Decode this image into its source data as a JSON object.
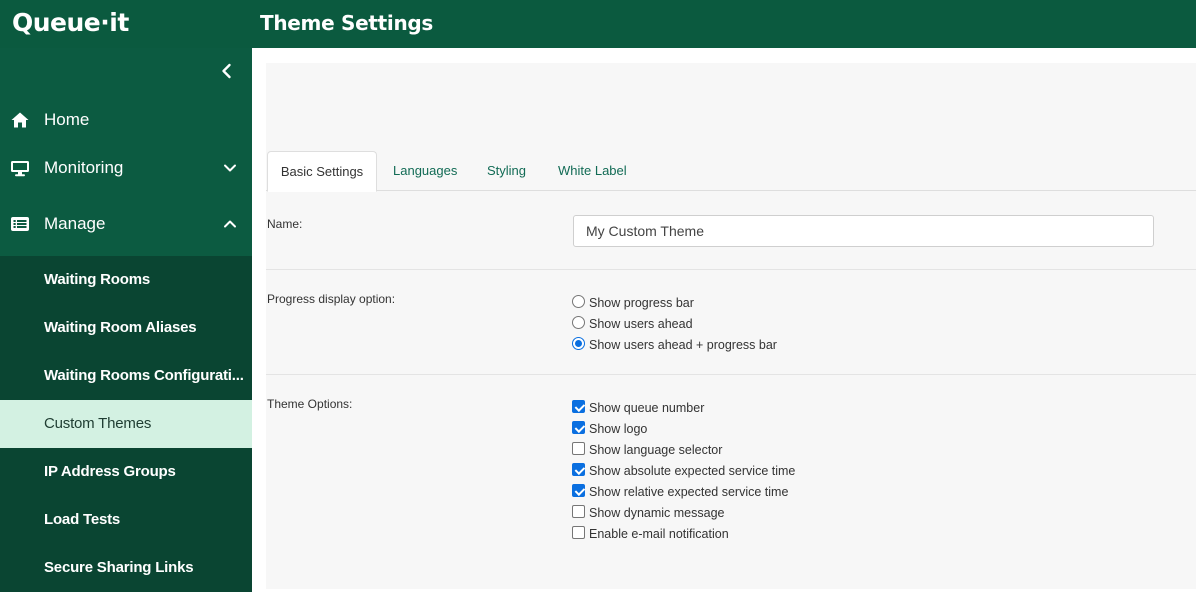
{
  "app": {
    "logo_text": "Queue·it",
    "page_title": "Theme Settings"
  },
  "sidebar": {
    "top_items": [
      {
        "label": "Home",
        "icon": "home-icon"
      },
      {
        "label": "Monitoring",
        "icon": "monitor-icon",
        "chevron": "down"
      },
      {
        "label": "Manage",
        "icon": "list-icon",
        "chevron": "up"
      }
    ],
    "sub_items": [
      {
        "label": "Waiting Rooms"
      },
      {
        "label": "Waiting Room Aliases"
      },
      {
        "label": "Waiting Rooms Configurati..."
      },
      {
        "label": "Custom Themes",
        "active": true
      },
      {
        "label": "IP Address Groups"
      },
      {
        "label": "Load Tests"
      },
      {
        "label": "Secure Sharing Links"
      }
    ]
  },
  "tabs": [
    {
      "label": "Basic Settings",
      "active": true
    },
    {
      "label": "Languages"
    },
    {
      "label": "Styling"
    },
    {
      "label": "White Label"
    }
  ],
  "form": {
    "name_label": "Name:",
    "name_value": "My Custom Theme",
    "progress_label": "Progress display option:",
    "progress_options": [
      {
        "label": "Show progress bar",
        "selected": false
      },
      {
        "label": "Show users ahead",
        "selected": false
      },
      {
        "label": "Show users ahead + progress bar",
        "selected": true
      }
    ],
    "theme_label": "Theme Options:",
    "theme_options": [
      {
        "label": "Show queue number",
        "checked": true
      },
      {
        "label": "Show logo",
        "checked": true
      },
      {
        "label": "Show language selector",
        "checked": false
      },
      {
        "label": "Show absolute expected service time",
        "checked": true
      },
      {
        "label": "Show relative expected service time",
        "checked": true
      },
      {
        "label": "Show dynamic message",
        "checked": false
      },
      {
        "label": "Enable e-mail notification",
        "checked": false
      }
    ]
  },
  "colors": {
    "brand": "#0b5a3f",
    "active_nav": "#d3f1e2",
    "control_accent": "#0a6fe0"
  }
}
